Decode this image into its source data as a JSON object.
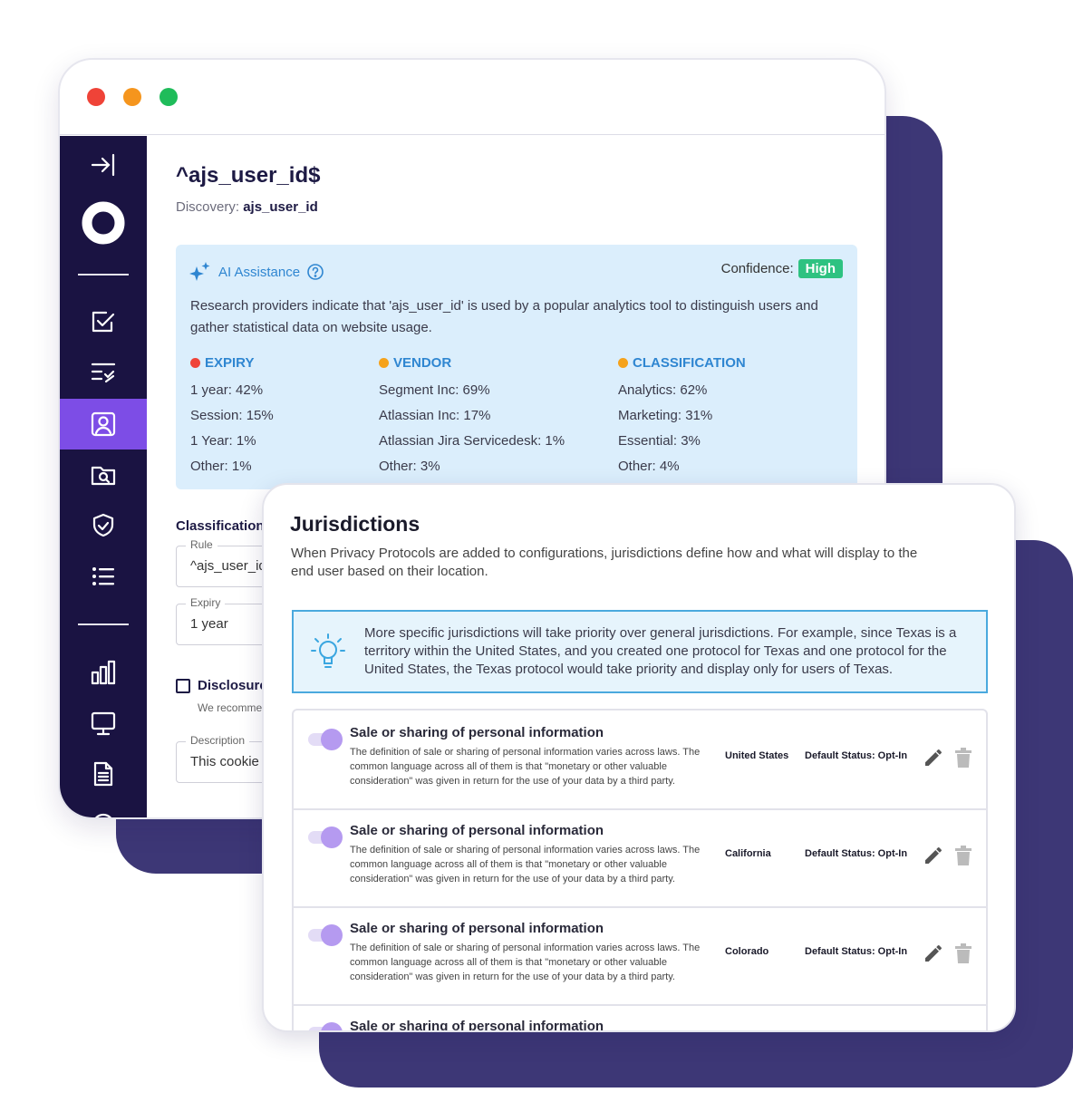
{
  "window": {
    "traffic_lights": [
      "#ef4338",
      "#f5951d",
      "#1fbc5a"
    ]
  },
  "sidebar": {
    "items": [
      {
        "name": "collapse-icon"
      },
      {
        "name": "logo-ring-icon"
      },
      {
        "name": "checklist-icon"
      },
      {
        "name": "list-check-icon"
      },
      {
        "name": "user-profile-icon",
        "active": true
      },
      {
        "name": "folder-search-icon"
      },
      {
        "name": "shield-check-icon"
      },
      {
        "name": "bullet-list-icon"
      },
      {
        "name": "bar-chart-icon"
      },
      {
        "name": "monitor-icon"
      },
      {
        "name": "document-icon"
      }
    ],
    "active_color": "#7d4de6",
    "bg_color": "#1a1342"
  },
  "detail": {
    "title": "^ajs_user_id$",
    "discovery_label": "Discovery:",
    "discovery_value": "ajs_user_id",
    "ai": {
      "label": "AI Assistance",
      "confidence_label": "Confidence:",
      "confidence_value": "High",
      "text": "Research providers indicate that 'ajs_user_id' is used by a popular analytics tool to distinguish users and gather statistical data on website usage.",
      "expiry": {
        "heading": "EXPIRY",
        "dot_color": "#ef4338",
        "rows": [
          "1 year: 42%",
          "Session: 15%",
          "1 Year: 1%",
          "Other: 1%"
        ]
      },
      "vendor": {
        "heading": "VENDOR",
        "dot_color": "#f5a21b",
        "rows": [
          "Segment Inc: 69%",
          "Atlassian Inc: 17%",
          "Atlassian Jira Servicedesk: 1%",
          "Other: 3%"
        ]
      },
      "classification": {
        "heading": "CLASSIFICATION",
        "dot_color": "#f5a21b",
        "rows": [
          "Analytics: 62%",
          "Marketing: 31%",
          "Essential: 3%",
          "Other: 4%"
        ]
      }
    },
    "section_title": "Classification",
    "rule": {
      "label": "Rule",
      "value": "^ajs_user_id$"
    },
    "expiry_field": {
      "label": "Expiry",
      "value": "1 year"
    },
    "disclosure": {
      "label": "Disclosure",
      "sub": "We recommend"
    },
    "description": {
      "label": "Description",
      "value": "This cookie"
    }
  },
  "jurisdictions": {
    "title": "Jurisdictions",
    "description": "When Privacy Protocols are added to configurations, jurisdictions define how and what will display to the end user based on their location.",
    "info": "More specific jurisdictions will take priority over general jurisdictions. For example, since Texas is a territory within the United States, and you created one protocol for Texas and one protocol for the United States, the Texas protocol would take priority and display only for users of Texas.",
    "rows": [
      {
        "title": "Sale or sharing of personal information",
        "desc": "The definition of sale or sharing of personal information varies across laws. The common language across all of them is that \"monetary or other valuable consideration\" was given in return for the use of your data by a third party.",
        "location": "United States",
        "status": "Default Status: Opt-In"
      },
      {
        "title": "Sale or sharing of personal information",
        "desc": "The definition of sale or sharing of personal information varies across laws. The common language across all of them is that \"monetary or other valuable consideration\" was given in return for the use of your data by a third party.",
        "location": "California",
        "status": "Default Status: Opt-In"
      },
      {
        "title": "Sale or sharing of personal information",
        "desc": "The definition of sale or sharing of personal information varies across laws. The common language across all of them is that \"monetary or other valuable consideration\" was given in return for the use of your data by a third party.",
        "location": "Colorado",
        "status": "Default Status: Opt-In"
      },
      {
        "title": "Sale or sharing of personal information",
        "desc": "",
        "location": "",
        "status": ""
      }
    ]
  }
}
